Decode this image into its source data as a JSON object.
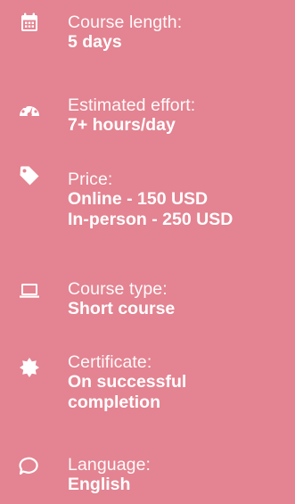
{
  "items": [
    {
      "icon": "calendar-icon",
      "label": "Course length:",
      "values": [
        "5 days"
      ]
    },
    {
      "icon": "speedometer-icon",
      "label": "Estimated effort:",
      "values": [
        "7+ hours/day"
      ]
    },
    {
      "icon": "price-tag-icon",
      "label": "Price:",
      "values": [
        "Online - 150 USD",
        "In-person - 250 USD"
      ]
    },
    {
      "icon": "laptop-icon",
      "label": "Course type:",
      "values": [
        "Short course"
      ]
    },
    {
      "icon": "certificate-badge-icon",
      "label": "Certificate:",
      "values": [
        "On successful",
        "completion"
      ]
    },
    {
      "icon": "speech-bubble-icon",
      "label": "Language:",
      "values": [
        "English"
      ]
    }
  ],
  "colors": {
    "background": "#e48391",
    "text": "#ffffff"
  }
}
